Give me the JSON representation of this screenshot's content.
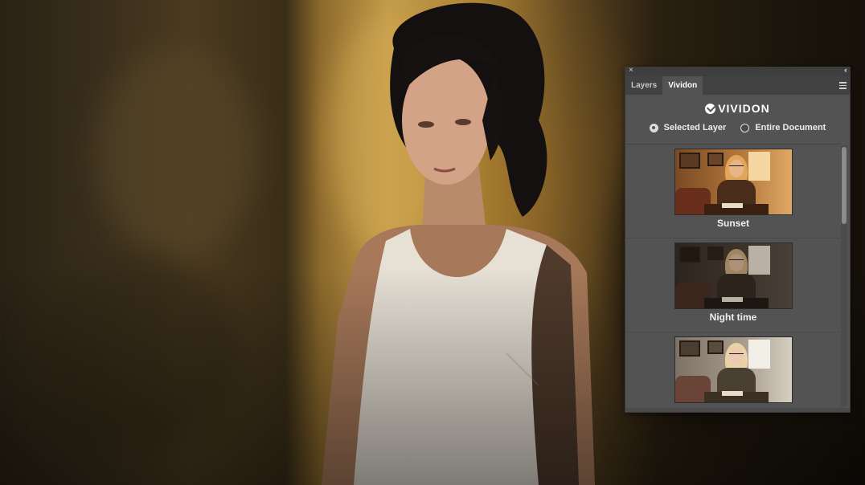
{
  "panel": {
    "close_glyph": "×",
    "collapse_glyph": "‹‹",
    "tabs": [
      {
        "label": "Layers",
        "active": false
      },
      {
        "label": "Vividon",
        "active": true
      }
    ],
    "brand_name": "VIVIDON",
    "scope": {
      "options": [
        {
          "label": "Selected Layer",
          "checked": true
        },
        {
          "label": "Entire Document",
          "checked": false
        }
      ]
    },
    "presets": [
      {
        "label": "Sunset",
        "tone": "sunset"
      },
      {
        "label": "Night time",
        "tone": "night"
      },
      {
        "label": "",
        "tone": "neutral"
      }
    ]
  },
  "colors": {
    "panel_bg": "#535353",
    "tab_bar": "#424242",
    "wall_light": "#c29a48",
    "wall_dark": "#2a2215"
  }
}
